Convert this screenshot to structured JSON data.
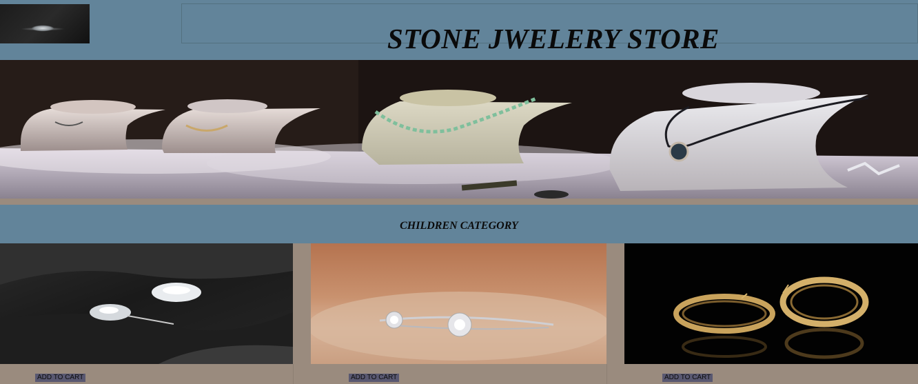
{
  "header": {
    "logo": "ring-logo-image",
    "title": "STONE JWELERY STORE"
  },
  "hero": {
    "image": "necklace-display-banner"
  },
  "category": {
    "title": "CHILDREN CATEGORY"
  },
  "products": [
    {
      "image": "diamond-earrings-image",
      "button_label": "ADD TO CART"
    },
    {
      "image": "diamond-bangle-image",
      "button_label": "ADD TO CART"
    },
    {
      "image": "gold-hoop-earrings-image",
      "button_label": "ADD TO CART"
    }
  ],
  "colors": {
    "header_bg": "#62849a",
    "page_bg": "#9a8b7e",
    "button_bg": "#595871"
  }
}
